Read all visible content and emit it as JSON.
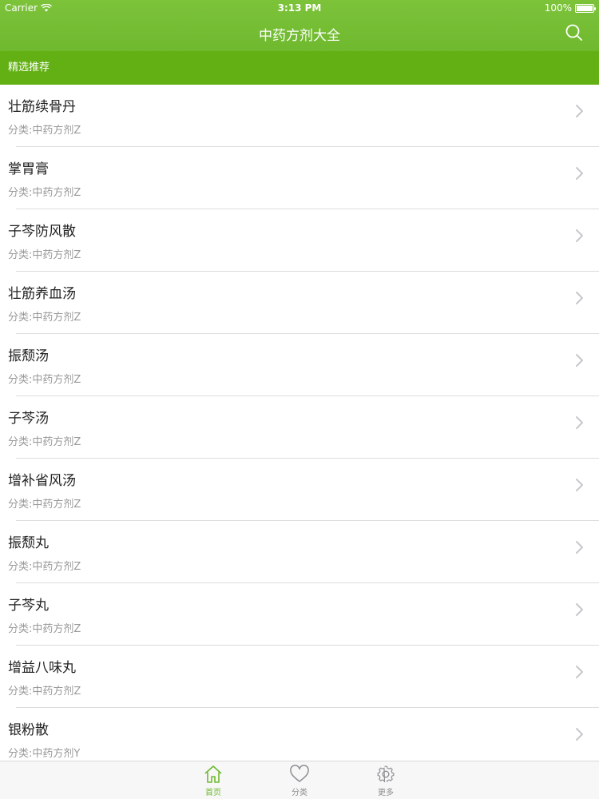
{
  "status_bar": {
    "carrier": "Carrier",
    "time": "3:13 PM",
    "battery": "100%",
    "battery_level": 1.0
  },
  "nav": {
    "title": "中药方剂大全",
    "search_icon": "search-icon"
  },
  "section": {
    "title": "精选推荐"
  },
  "list": [
    {
      "title": "壮筋续骨丹",
      "subtitle": "分类:中药方剂Z"
    },
    {
      "title": "掌胃膏",
      "subtitle": "分类:中药方剂Z"
    },
    {
      "title": "子芩防风散",
      "subtitle": "分类:中药方剂Z"
    },
    {
      "title": "壮筋养血汤",
      "subtitle": "分类:中药方剂Z"
    },
    {
      "title": "振颓汤",
      "subtitle": "分类:中药方剂Z"
    },
    {
      "title": "子芩汤",
      "subtitle": "分类:中药方剂Z"
    },
    {
      "title": "增补省风汤",
      "subtitle": "分类:中药方剂Z"
    },
    {
      "title": "振颓丸",
      "subtitle": "分类:中药方剂Z"
    },
    {
      "title": "子芩丸",
      "subtitle": "分类:中药方剂Z"
    },
    {
      "title": "增益八味丸",
      "subtitle": "分类:中药方剂Z"
    },
    {
      "title": "银粉散",
      "subtitle": "分类:中药方剂Y"
    }
  ],
  "tabbar": {
    "tabs": [
      {
        "label": "首页",
        "icon": "home-icon",
        "active": true
      },
      {
        "label": "分类",
        "icon": "heart-icon",
        "active": false
      },
      {
        "label": "更多",
        "icon": "gear-icon",
        "active": false
      }
    ]
  },
  "colors": {
    "nav_green": "#6fb92f",
    "section_green": "#63b014",
    "subtitle_gray": "#999999"
  }
}
